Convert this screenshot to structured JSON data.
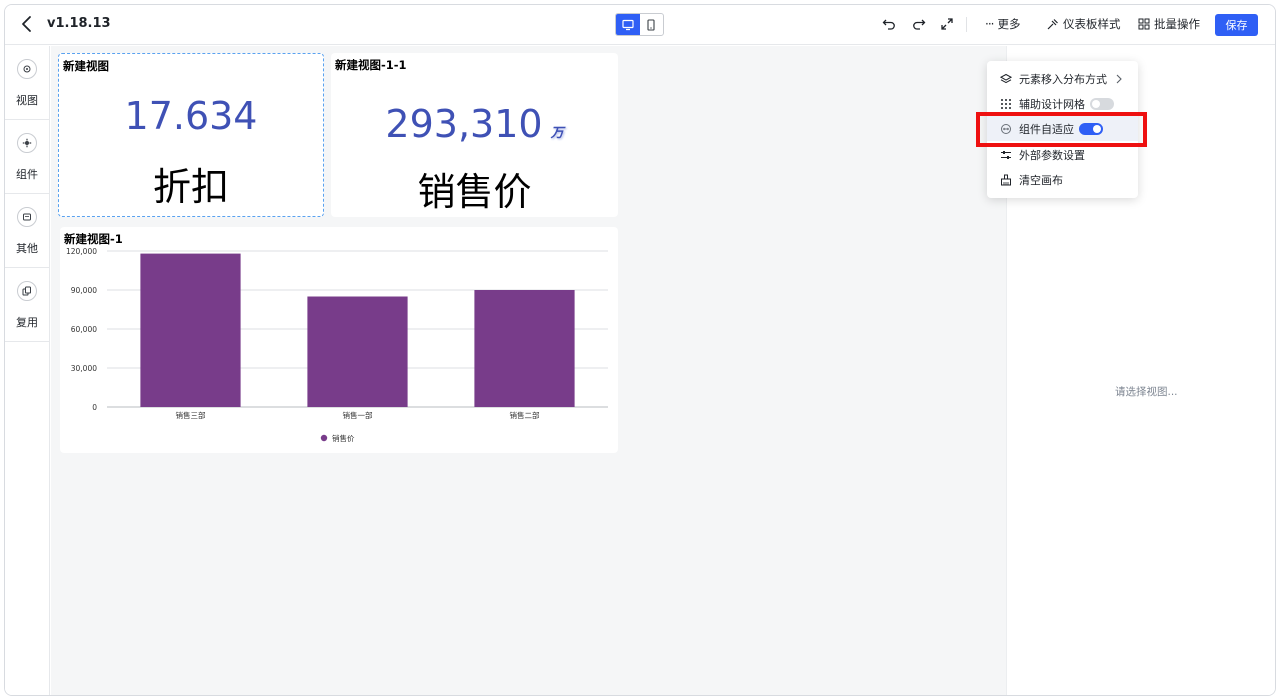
{
  "header": {
    "version": "v1.18.13",
    "more_label": "更多",
    "dashboard_style_label": "仪表板样式",
    "batch_label": "批量操作",
    "save_label": "保存",
    "icons": [
      "back-icon",
      "desktop-icon",
      "mobile-icon",
      "undo-icon",
      "redo-icon",
      "fullscreen-icon"
    ]
  },
  "sidebar": {
    "items": [
      {
        "label": "视图",
        "icon": "view-icon"
      },
      {
        "label": "组件",
        "icon": "component-icon"
      },
      {
        "label": "其他",
        "icon": "other-icon"
      },
      {
        "label": "复用",
        "icon": "reuse-icon"
      }
    ]
  },
  "cards": {
    "kpi1": {
      "title": "新建视图",
      "value": "17.634",
      "label": "折扣"
    },
    "kpi2": {
      "title": "新建视图-1-1",
      "value": "293,310",
      "unit": "万",
      "label": "销售价"
    },
    "chart": {
      "title": "新建视图-1"
    }
  },
  "chart_data": {
    "type": "bar",
    "categories": [
      "销售三部",
      "销售一部",
      "销售二部"
    ],
    "series": [
      {
        "name": "销售价",
        "values": [
          118000,
          85000,
          90000
        ]
      }
    ],
    "ylim": [
      0,
      120000
    ],
    "yticks": [
      "0",
      "30,000",
      "60,000",
      "90,000",
      "120,000"
    ],
    "ytick_values": [
      0,
      30000,
      60000,
      90000,
      120000
    ],
    "grid": true,
    "legend": "bottom-center",
    "color": "#783c8a"
  },
  "menu": {
    "items": [
      {
        "label": "元素移入分布方式",
        "icon": "layers-icon"
      },
      {
        "label": "辅助设计网格",
        "icon": "grid-dots-icon",
        "toggle": false
      },
      {
        "label": "组件自适应",
        "icon": "adaptive-icon",
        "toggle": true
      },
      {
        "label": "外部参数设置",
        "icon": "sliders-icon"
      },
      {
        "label": "清空画布",
        "icon": "clear-icon"
      }
    ]
  },
  "right_panel": {
    "hint": "请选择视图..."
  },
  "colors": {
    "accent": "#2f5ff5",
    "kpi_value": "#3f51b5",
    "bar": "#783c8a",
    "annotation": "#ee1010"
  }
}
